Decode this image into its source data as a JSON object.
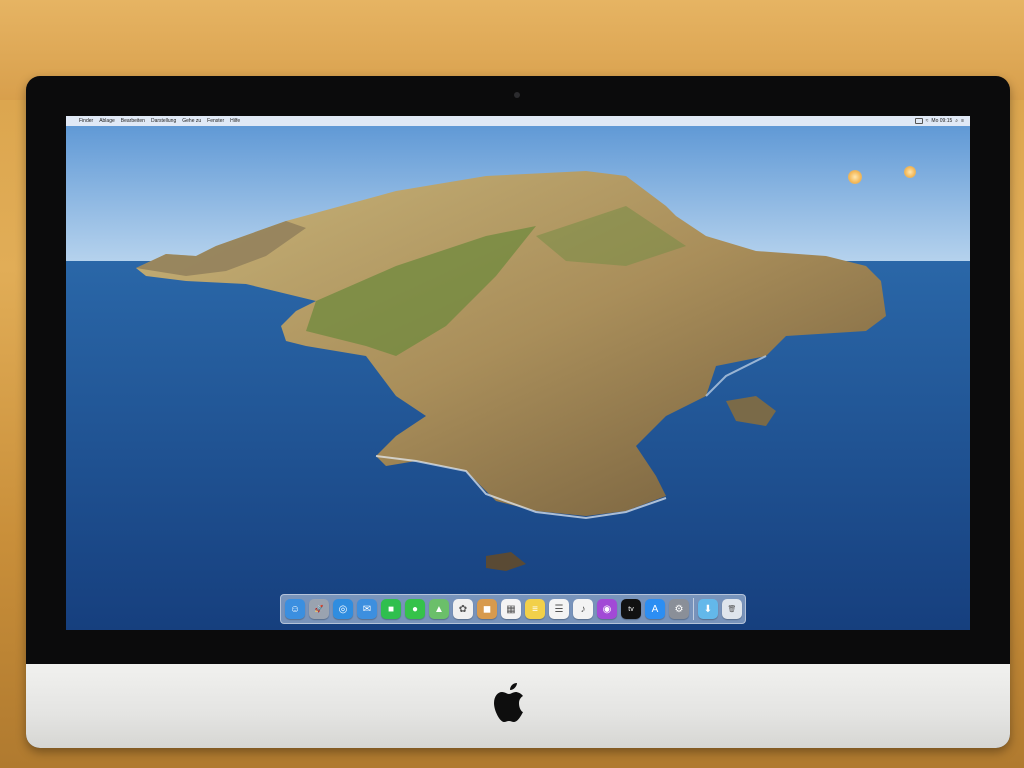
{
  "menubar": {
    "items": [
      "Finder",
      "Ablage",
      "Bearbeiten",
      "Darstellung",
      "Gehe zu",
      "Fenster",
      "Hilfe"
    ],
    "clock": "Mo 09:15"
  },
  "dock": {
    "apps": [
      {
        "icon": "finder-icon",
        "color": "#3b8fe0",
        "glyph": "☺"
      },
      {
        "icon": "launchpad-icon",
        "color": "#9aa3b0",
        "glyph": "🚀"
      },
      {
        "icon": "safari-icon",
        "color": "#2f8de0",
        "glyph": "◎"
      },
      {
        "icon": "mail-icon",
        "color": "#3d8fdf",
        "glyph": "✉"
      },
      {
        "icon": "facetime-icon",
        "color": "#2fbf4e",
        "glyph": "■"
      },
      {
        "icon": "messages-icon",
        "color": "#35c24a",
        "glyph": "●"
      },
      {
        "icon": "maps-icon",
        "color": "#6bbf6a",
        "glyph": "▲"
      },
      {
        "icon": "photos-icon",
        "color": "#f0f0f0",
        "glyph": "✿"
      },
      {
        "icon": "contacts-icon",
        "color": "#d79a4e",
        "glyph": "◼"
      },
      {
        "icon": "calendar-icon",
        "color": "#f4f4f4",
        "glyph": "▦"
      },
      {
        "icon": "notes-icon",
        "color": "#f2d04a",
        "glyph": "≡"
      },
      {
        "icon": "reminders-icon",
        "color": "#f4f4f4",
        "glyph": "☰"
      },
      {
        "icon": "music-icon",
        "color": "#f3f3f3",
        "glyph": "♪"
      },
      {
        "icon": "podcasts-icon",
        "color": "#a24ad6",
        "glyph": "◉"
      },
      {
        "icon": "tv-icon",
        "color": "#111111",
        "glyph": "tv"
      },
      {
        "icon": "app-store-icon",
        "color": "#2c8ef3",
        "glyph": "A"
      },
      {
        "icon": "system-preferences-icon",
        "color": "#8a8f98",
        "glyph": "⚙"
      }
    ],
    "extras": [
      {
        "icon": "downloads-folder-icon",
        "color": "#63b8ea",
        "glyph": "⬇"
      },
      {
        "icon": "trash-icon",
        "color": "#dfe5ec",
        "glyph": "🗑"
      }
    ]
  }
}
